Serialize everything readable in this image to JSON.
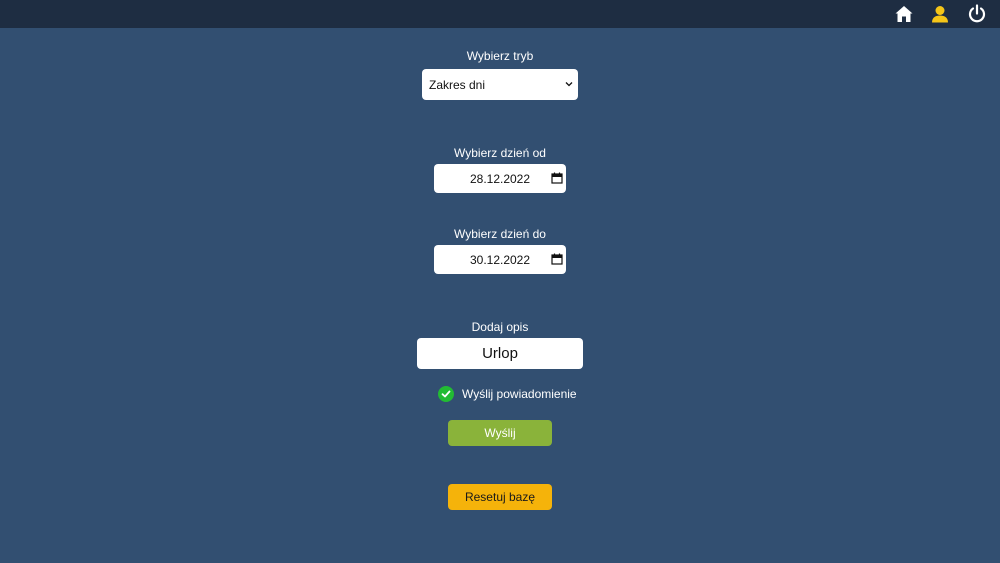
{
  "topbar": {
    "icons": [
      "home-icon",
      "user-icon",
      "power-icon"
    ],
    "user_icon_color": "#f5c518"
  },
  "mode": {
    "label": "Wybierz tryb",
    "selected": "Zakres dni"
  },
  "date_from": {
    "label": "Wybierz dzień od",
    "value": "28.12.2022"
  },
  "date_to": {
    "label": "Wybierz dzień do",
    "value": "30.12.2022"
  },
  "description": {
    "label": "Dodaj opis",
    "value": "Urlop"
  },
  "notify": {
    "label": "Wyślij powiadomienie",
    "checked": true
  },
  "buttons": {
    "send_label": "Wyślij",
    "reset_label": "Resetuj bazę"
  },
  "colors": {
    "background": "#324f71",
    "topbar": "#1e2d42",
    "send_button": "#8ab33a",
    "reset_button": "#f5b30a",
    "check": "#22bb33"
  }
}
